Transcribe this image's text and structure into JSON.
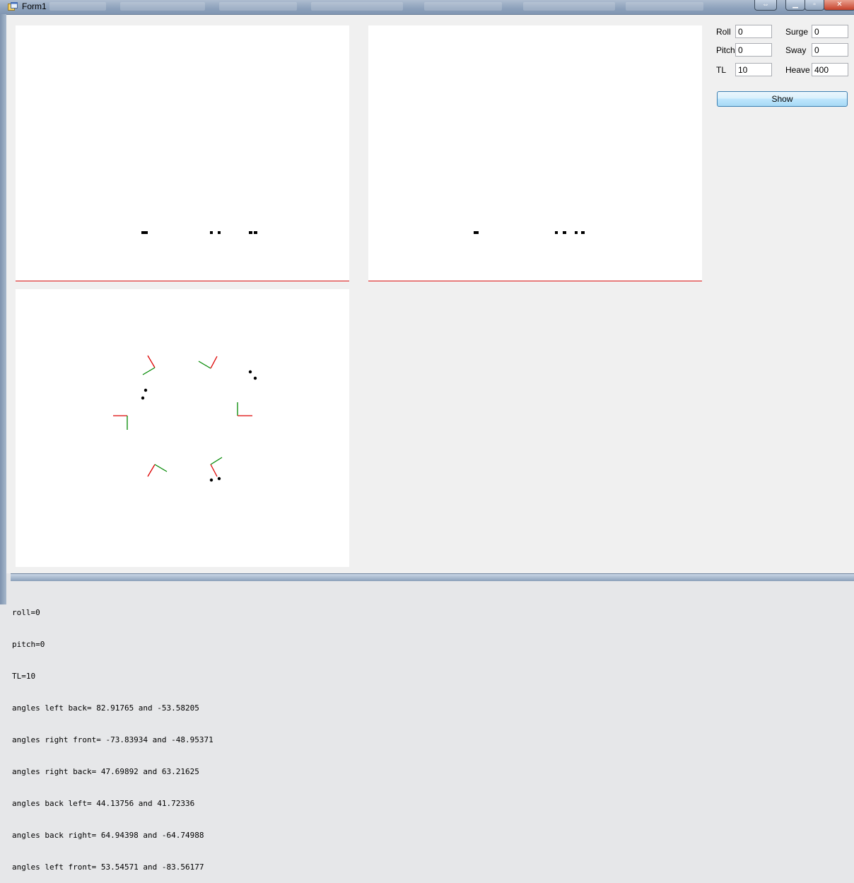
{
  "window": {
    "title": "Form1"
  },
  "controls": {
    "roll": {
      "label": "Roll",
      "value": "0"
    },
    "surge": {
      "label": "Surge",
      "value": "0"
    },
    "pitch": {
      "label": "Pitch",
      "value": "0"
    },
    "sway": {
      "label": "Sway",
      "value": "0"
    },
    "tl": {
      "label": "TL",
      "value": "10"
    },
    "heave": {
      "label": "Heave",
      "value": "400"
    },
    "show_label": "Show"
  },
  "console": {
    "lines": [
      "roll=0",
      "pitch=0",
      "TL=10",
      "angles left back= 82.91765 and -53.58205",
      "angles right front= -73.83934 and -48.95371",
      "angles right back= 47.69892 and 63.21625",
      "angles back left= 44.13756 and 41.72336",
      "angles back right= 64.94398 and -64.74988",
      "angles left front= 53.54571 and -83.56177"
    ]
  },
  "colors": {
    "ground_line": "#cc0000",
    "link_red": "#dd0000",
    "link_green": "#008800",
    "points": "#000000"
  }
}
